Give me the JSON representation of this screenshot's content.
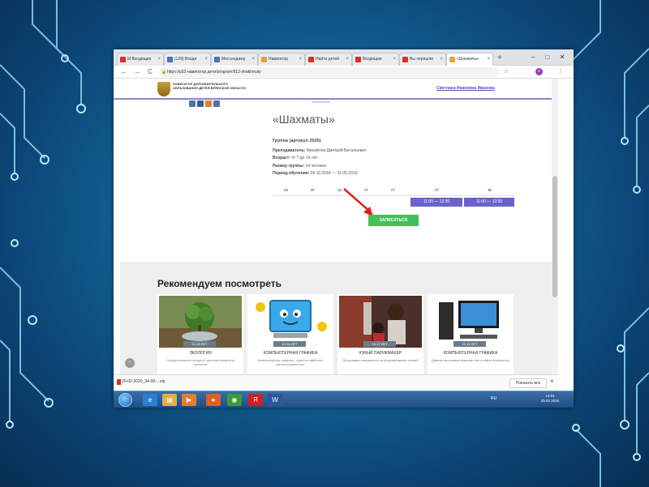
{
  "browser": {
    "tabs": [
      {
        "label": "M  Входящие",
        "color": "#d93025"
      },
      {
        "label": "(129) Входя",
        "color": "#4a76a8"
      },
      {
        "label": "Мессенджер",
        "color": "#4a76a8"
      },
      {
        "label": "Навигатор",
        "color": "#e8a33c"
      },
      {
        "label": "Найти детей",
        "color": "#d93025"
      },
      {
        "label": "Входящие",
        "color": "#d93025"
      },
      {
        "label": "Вы перешли",
        "color": "#d93025"
      },
      {
        "label": "«Шахматы»",
        "color": "#e8a33c"
      }
    ],
    "url": "https://p32-навигатор.дети/program/912-shakhmaty",
    "nav_icons": {
      "back": "←",
      "forward": "→",
      "reload": "C"
    },
    "window_buttons": {
      "minimize": "–",
      "maximize": "□",
      "close": "✕"
    }
  },
  "site": {
    "org_name": "Навигатор дополнительного образования детей Брянской области",
    "user_name": "Светлана Ивановна Иванова",
    "social": [
      {
        "color": "#4a76a8"
      },
      {
        "color": "#3b5998"
      },
      {
        "color": "#e67e22"
      },
      {
        "color": "#4a76a8"
      }
    ]
  },
  "activity": {
    "title": "«Шахматы»",
    "group": "Группа (артикул 2026)",
    "teacher_label": "Преподаватель:",
    "teacher": "Михайлов Дмитрий Витальевич",
    "age_label": "Возраст:",
    "age": "от 7 до 14 лет",
    "size_label": "Размер группы:",
    "size": "14 человек",
    "period_label": "Период обучения:",
    "period": "06.10.2018 — 31.05.2019",
    "days": [
      "пн",
      "вт",
      "ср",
      "чт",
      "пт",
      "сб",
      "вс"
    ],
    "slots": [
      {
        "day": "сб",
        "time": "11:00 — 12:30"
      },
      {
        "day": "вс",
        "time": "11:00 — 12:30"
      }
    ],
    "signup_label": "ЗАПИСАТЬСЯ"
  },
  "recommend": {
    "title": "Рекомендуем посмотреть",
    "cards": [
      {
        "age": "12-16 ЛЕТ",
        "title": "ЭКОЛОГИЯ",
        "desc": "Осуществляется процесс изучения вопросов экологии"
      },
      {
        "age": "12-16 ЛЕТ",
        "title": "КОМПЬЮТЕРНАЯ ГРАФИКА",
        "desc": "Компьютерная графика - одна из наиболее распространенных"
      },
      {
        "age": "13-17 ЛЕТ",
        "title": "ЮНЫЙ ПАРИКМАХЕР",
        "desc": "Программа направлена на формирование знаний"
      },
      {
        "age": "11-16 ЛЕТ",
        "title": "КОМПЬЮТЕРНАЯ ГРАФИКА",
        "desc": "Данная программа выводит нас в новое измерение"
      }
    ]
  },
  "downloads": {
    "file": "20-02-2020_34-09-...zip",
    "show_all": "Показать все"
  },
  "taskbar": {
    "apps": [
      {
        "icon": "ie-icon",
        "glyph": "e",
        "color": "#2a7fd4"
      },
      {
        "icon": "folder-icon",
        "glyph": "▤",
        "color": "#e0b040"
      },
      {
        "icon": "media-player-icon",
        "glyph": "▶",
        "color": "#e08030"
      },
      {
        "icon": "firefox-icon",
        "glyph": "●",
        "color": "#e06020"
      },
      {
        "icon": "chrome-icon",
        "glyph": "◉",
        "color": "#3a9a3a"
      },
      {
        "icon": "yandex-icon",
        "glyph": "Я",
        "color": "#cc2020"
      },
      {
        "icon": "word-icon",
        "glyph": "W",
        "color": "#2b579a"
      }
    ],
    "lang": "RU",
    "time": "13:51",
    "date": "25.02.2020"
  }
}
